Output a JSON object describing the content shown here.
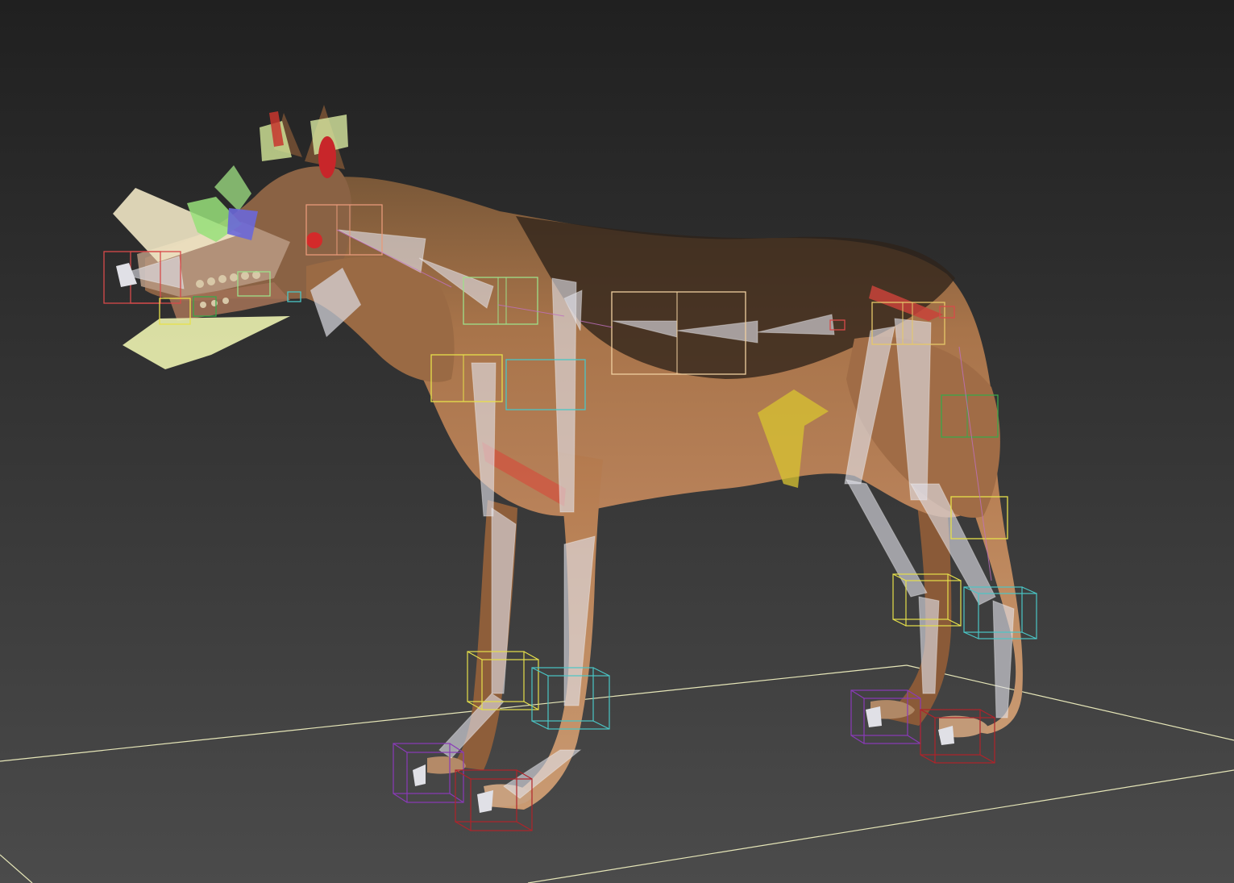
{
  "viewport": {
    "background_colors": {
      "top": "#222222",
      "bottom": "#4a4a4a"
    },
    "grid_color": "#e8e8c0"
  },
  "model": {
    "subject": "wolf",
    "coat_colors": {
      "light": "#c08556",
      "mid": "#9a6a44",
      "dark": "#3a2a1e"
    }
  },
  "rig": {
    "bone_color": "#e4e4ea",
    "controller_colors": {
      "red": "#d94a4a",
      "yellow": "#e6e04a",
      "green": "#3aa84a",
      "cyan": "#4ac6c6",
      "purple": "#8a3ab8",
      "dark_red": "#b0232a",
      "salmon": "#e89a7a",
      "light_green": "#9ee08a"
    },
    "helpers": [
      "ear-helper",
      "jaw-helper",
      "eye-helper",
      "spine-helper",
      "tail-helper"
    ]
  }
}
